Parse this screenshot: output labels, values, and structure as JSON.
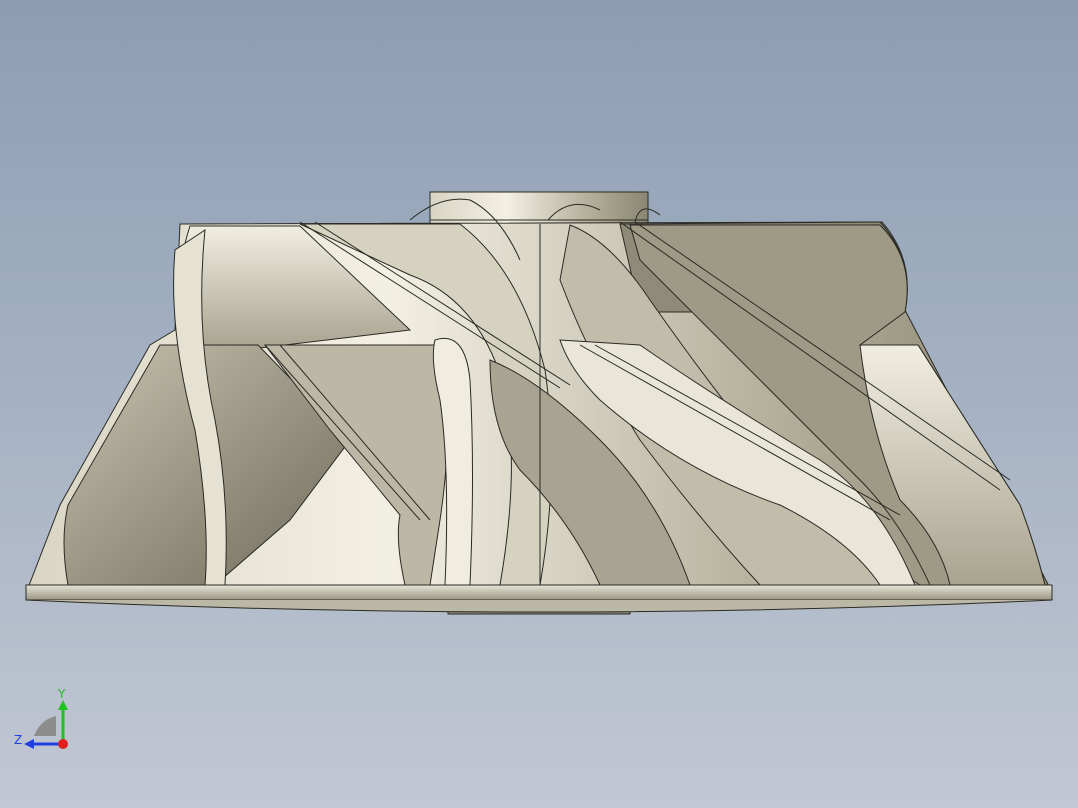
{
  "viewport": {
    "background_top": "#8c9db3",
    "background_bottom": "#c2c7d3"
  },
  "model": {
    "icon": "impeller-model",
    "colors": {
      "metal_light": "#f2efe2",
      "metal_mid": "#cfcab7",
      "metal_dark": "#8e8a78",
      "edge": "#2a2a24"
    }
  },
  "triad": {
    "y_label": "Y",
    "z_label": "Z",
    "colors": {
      "y_axis": "#1fc21f",
      "z_axis": "#1f3fe0",
      "x_axis": "#e01f1f"
    }
  }
}
